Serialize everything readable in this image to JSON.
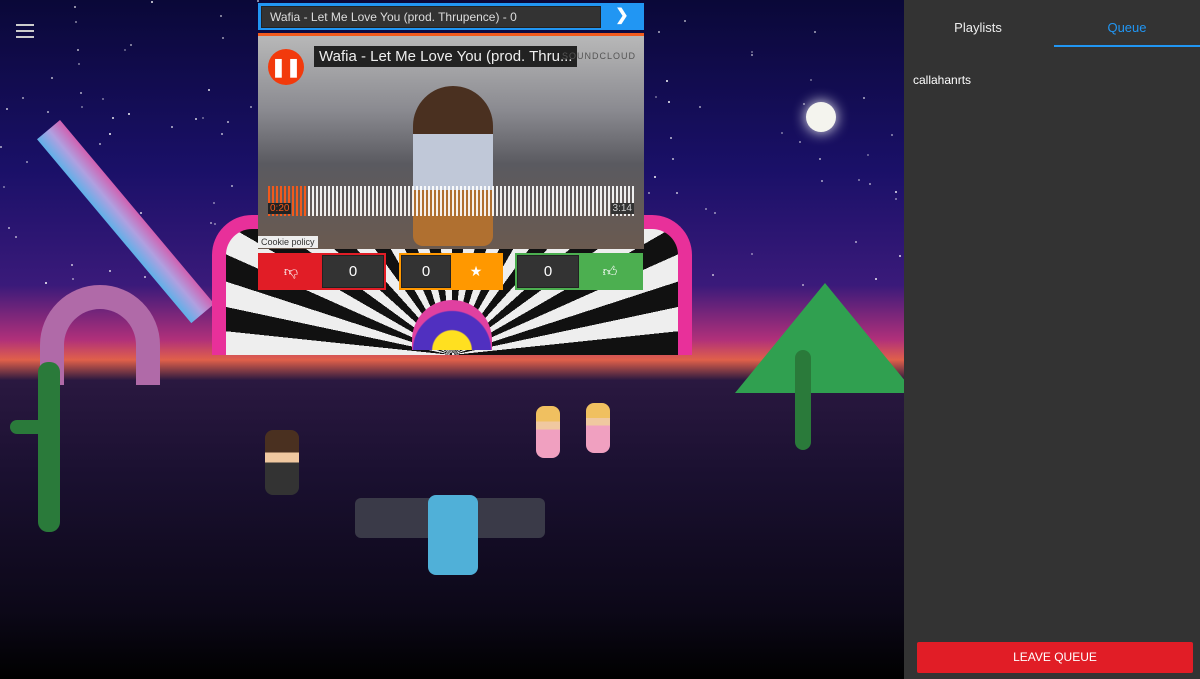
{
  "search": {
    "value": "Wafia - Let Me Love You (prod. Thrupence) - 0",
    "go_icon": "chevron-right-icon"
  },
  "player": {
    "title": "Wafia - Let Me Love You (prod. Thru...",
    "provider": "SOUNDCLOUD",
    "current_time": "0:20",
    "total_time": "3:14",
    "progress": 0.103,
    "accent": "#f25a1c"
  },
  "cookie_policy": "Cookie policy",
  "votes": {
    "dislike": {
      "count": "0",
      "icon": "thumbs-down-icon",
      "color": "#e11d26"
    },
    "grab": {
      "count": "0",
      "icon": "star-icon",
      "color": "#ff9800"
    },
    "like": {
      "count": "0",
      "icon": "thumbs-up-icon",
      "color": "#4caf50"
    }
  },
  "sidebar": {
    "tabs": [
      {
        "label": "Playlists"
      },
      {
        "label": "Queue",
        "active": true
      }
    ],
    "queue": [
      "callahanrts"
    ],
    "leave_label": "LEAVE QUEUE"
  }
}
